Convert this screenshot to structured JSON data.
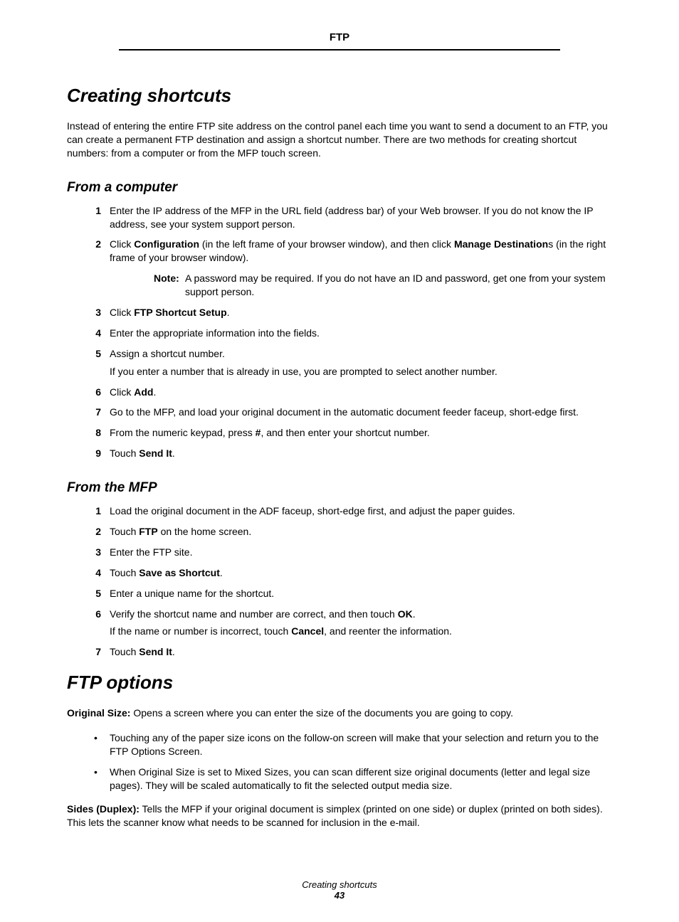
{
  "header": {
    "title": "FTP"
  },
  "sec1": {
    "heading": "Creating shortcuts",
    "intro": "Instead of entering the entire FTP site address on the control panel each time you want to send a document to an FTP, you can create a permanent FTP destination and assign a shortcut number. There are two methods for creating shortcut numbers: from a computer or from the MFP touch screen."
  },
  "sub_comp": {
    "heading": "From a computer",
    "step1": {
      "num": "1",
      "text": "Enter the IP address of the MFP in the URL field (address bar) of your Web browser. If you do not know the IP address, see your system support person."
    },
    "step2": {
      "num": "2",
      "pre": "Click ",
      "b1": "Configuration",
      "mid": " (in the left frame of your browser window), and then click ",
      "b2": "Manage Destination",
      "post": "s (in the right frame of your browser window)."
    },
    "note": {
      "label": "Note:",
      "text": "A password may be required. If you do not have an ID and password, get one from your system support person."
    },
    "step3": {
      "num": "3",
      "pre": "Click ",
      "b": "FTP Shortcut Setup",
      "post": "."
    },
    "step4": {
      "num": "4",
      "text": "Enter the appropriate information into the fields."
    },
    "step5": {
      "num": "5",
      "text": "Assign a shortcut number.",
      "sub": "If you enter a number that is already in use, you are prompted to select another number."
    },
    "step6": {
      "num": "6",
      "pre": "Click ",
      "b": "Add",
      "post": "."
    },
    "step7": {
      "num": "7",
      "text": "Go to the MFP, and load your original document in the automatic document feeder faceup, short-edge first."
    },
    "step8": {
      "num": "8",
      "pre": "From the numeric keypad, press ",
      "b": "#",
      "post": ", and then enter your shortcut number."
    },
    "step9": {
      "num": "9",
      "pre": "Touch ",
      "b": "Send It",
      "post": "."
    }
  },
  "sub_mfp": {
    "heading": "From the MFP",
    "step1": {
      "num": "1",
      "text": "Load the original document in the ADF faceup, short-edge first, and adjust the paper guides."
    },
    "step2": {
      "num": "2",
      "pre": "Touch ",
      "b": "FTP",
      "post": " on the home screen."
    },
    "step3": {
      "num": "3",
      "text": "Enter the FTP site."
    },
    "step4": {
      "num": "4",
      "pre": "Touch ",
      "b": "Save as Shortcut",
      "post": "."
    },
    "step5": {
      "num": "5",
      "text": "Enter a unique name for the shortcut."
    },
    "step6": {
      "num": "6",
      "pre": "Verify the shortcut name and number are correct, and then touch ",
      "b": "OK",
      "post": ".",
      "sub_pre": "If the name or number is incorrect, touch ",
      "sub_b": "Cancel",
      "sub_post": ", and reenter the information."
    },
    "step7": {
      "num": "7",
      "pre": "Touch ",
      "b": "Send It",
      "post": "."
    }
  },
  "sec2": {
    "heading": "FTP options",
    "orig_label": "Original Size:",
    "orig_text": " Opens a screen where you can enter the size of the documents you are going to copy.",
    "bullet1": "Touching any of the paper size icons on the follow-on screen will make that your selection and return you to the FTP Options Screen.",
    "bullet2": "When Original Size is set to Mixed Sizes, you can scan different size original documents (letter and legal size pages). They will be scaled automatically to fit the selected output media size.",
    "sides_label": "Sides (Duplex):",
    "sides_text": " Tells the MFP if your original document is simplex (printed on one side) or duplex (printed on both sides). This lets the scanner know what needs to be scanned for inclusion in the e-mail."
  },
  "footer": {
    "title": "Creating shortcuts",
    "page": "43"
  }
}
